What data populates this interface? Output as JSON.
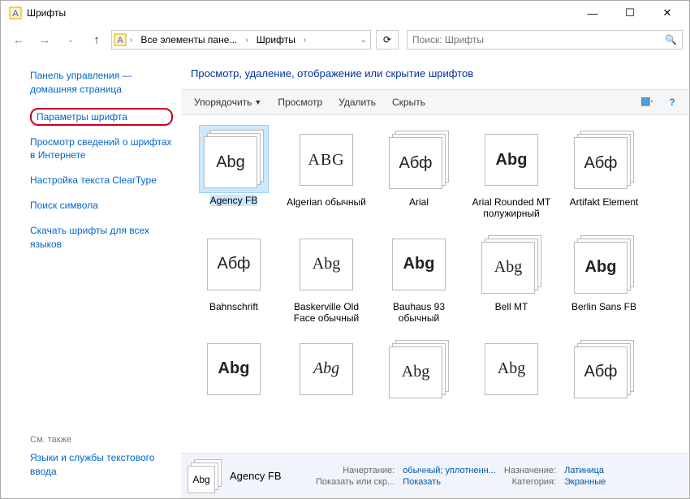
{
  "title": "Шрифты",
  "breadcrumb": {
    "seg1": "Все элементы пане...",
    "seg2": "Шрифты"
  },
  "search": {
    "placeholder": "Поиск: Шрифты"
  },
  "sidebar": {
    "links": [
      "Панель управления — домашняя страница",
      "Параметры шрифта",
      "Просмотр сведений о шрифтах в Интернете",
      "Настройка текста ClearType",
      "Поиск символа",
      "Скачать шрифты для всех языков"
    ],
    "footer_label": "См. также",
    "footer_link": "Языки и службы текстового ввода"
  },
  "main": {
    "heading": "Просмотр, удаление, отображение или скрытие шрифтов",
    "toolbar": {
      "organize": "Упорядочить",
      "preview": "Просмотр",
      "delete": "Удалить",
      "hide": "Скрыть"
    }
  },
  "fonts": [
    {
      "label": "Agency FB",
      "preview": "Abg",
      "stack": true,
      "selected": true,
      "style": "font-family:'Agency FB',sans-serif;font-stretch:condensed"
    },
    {
      "label": "Algerian обычный",
      "preview": "ABG",
      "stack": false,
      "style": "font-family:'Algerian',serif;letter-spacing:1px"
    },
    {
      "label": "Arial",
      "preview": "Абф",
      "stack": true,
      "style": "font-family:Arial,sans-serif"
    },
    {
      "label": "Arial Rounded MT полужирный",
      "preview": "Abg",
      "stack": false,
      "style": "font-family:'Arial Rounded MT Bold',Arial,sans-serif;font-weight:700"
    },
    {
      "label": "Artifakt Element",
      "preview": "Абф",
      "stack": true,
      "style": "font-family:sans-serif"
    },
    {
      "label": "Bahnschrift",
      "preview": "Абф",
      "stack": false,
      "style": "font-family:Bahnschrift,sans-serif"
    },
    {
      "label": "Baskerville Old Face обычный",
      "preview": "Abg",
      "stack": false,
      "style": "font-family:'Baskerville Old Face',serif"
    },
    {
      "label": "Bauhaus 93 обычный",
      "preview": "Abg",
      "stack": false,
      "style": "font-family:'Bauhaus 93',sans-serif;font-weight:900"
    },
    {
      "label": "Bell MT",
      "preview": "Abg",
      "stack": true,
      "style": "font-family:'Bell MT',serif"
    },
    {
      "label": "Berlin Sans FB",
      "preview": "Abg",
      "stack": true,
      "style": "font-family:'Berlin Sans FB',sans-serif;font-weight:600"
    },
    {
      "label": "",
      "preview": "Abg",
      "stack": false,
      "style": "font-family:sans-serif;font-weight:900"
    },
    {
      "label": "",
      "preview": "Abg",
      "stack": false,
      "style": "font-family:cursive;font-style:italic"
    },
    {
      "label": "",
      "preview": "Abg",
      "stack": true,
      "style": "font-family:serif"
    },
    {
      "label": "",
      "preview": "Abg",
      "stack": false,
      "style": "font-family:serif;font-stretch:condensed"
    },
    {
      "label": "",
      "preview": "Абф",
      "stack": true,
      "style": "font-family:sans-serif"
    }
  ],
  "details": {
    "name": "Agency FB",
    "preview": "Abg",
    "k1": "Начертание:",
    "v1": "обычный; уплотненн...",
    "k2": "Назначение:",
    "v2": "Латиница",
    "k3": "Показать или скр...",
    "v3": "Показать",
    "k4": "Категория:",
    "v4": "Экранные"
  }
}
